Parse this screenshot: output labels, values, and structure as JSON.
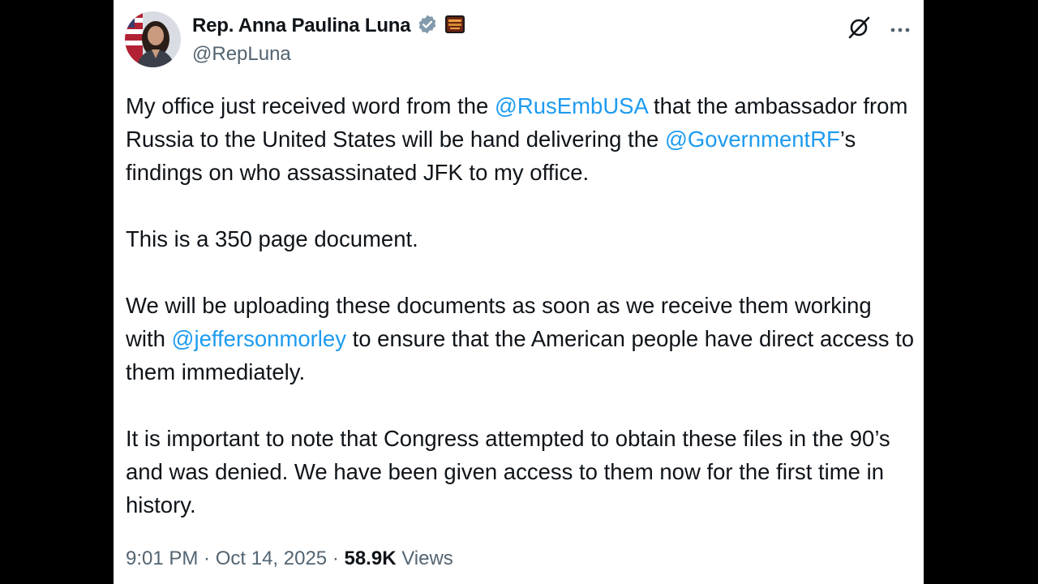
{
  "author": {
    "display_name": "Rep. Anna Paulina Luna",
    "handle": "@RepLuna",
    "verified_badge_icon": "verified-badge-icon",
    "affiliation_icon": "affiliation-badge-icon"
  },
  "actions": {
    "grok_icon": "grok-icon",
    "more_icon": "more-options-icon"
  },
  "post": {
    "p1_a": "My office just received word from the ",
    "p1_mention1": "@RusEmbUSA",
    "p1_b": " that the ambassador from Russia to the United States will be hand delivering the ",
    "p1_mention2": "@GovernmentRF",
    "p1_c": "’s findings on who assassinated JFK to my office.",
    "p2": "This is a 350 page document.",
    "p3_a": "We will be uploading these documents as soon as we receive them working with ",
    "p3_mention": "@jeffersonmorley",
    "p3_b": " to ensure that the American people have direct access to them immediately.",
    "p4": "It is important to note that Congress attempted to obtain these files in the 90’s and was denied.  We have been given access to them now for the first time in history."
  },
  "meta": {
    "time": "9:01 PM",
    "date": "Oct 14, 2025",
    "separator": " · ",
    "views_count": "58.9K",
    "views_label": " Views"
  },
  "colors": {
    "link": "#1d9bf0",
    "muted": "#536471",
    "text": "#0f1419",
    "background": "#ffffff",
    "frame": "#000000"
  }
}
